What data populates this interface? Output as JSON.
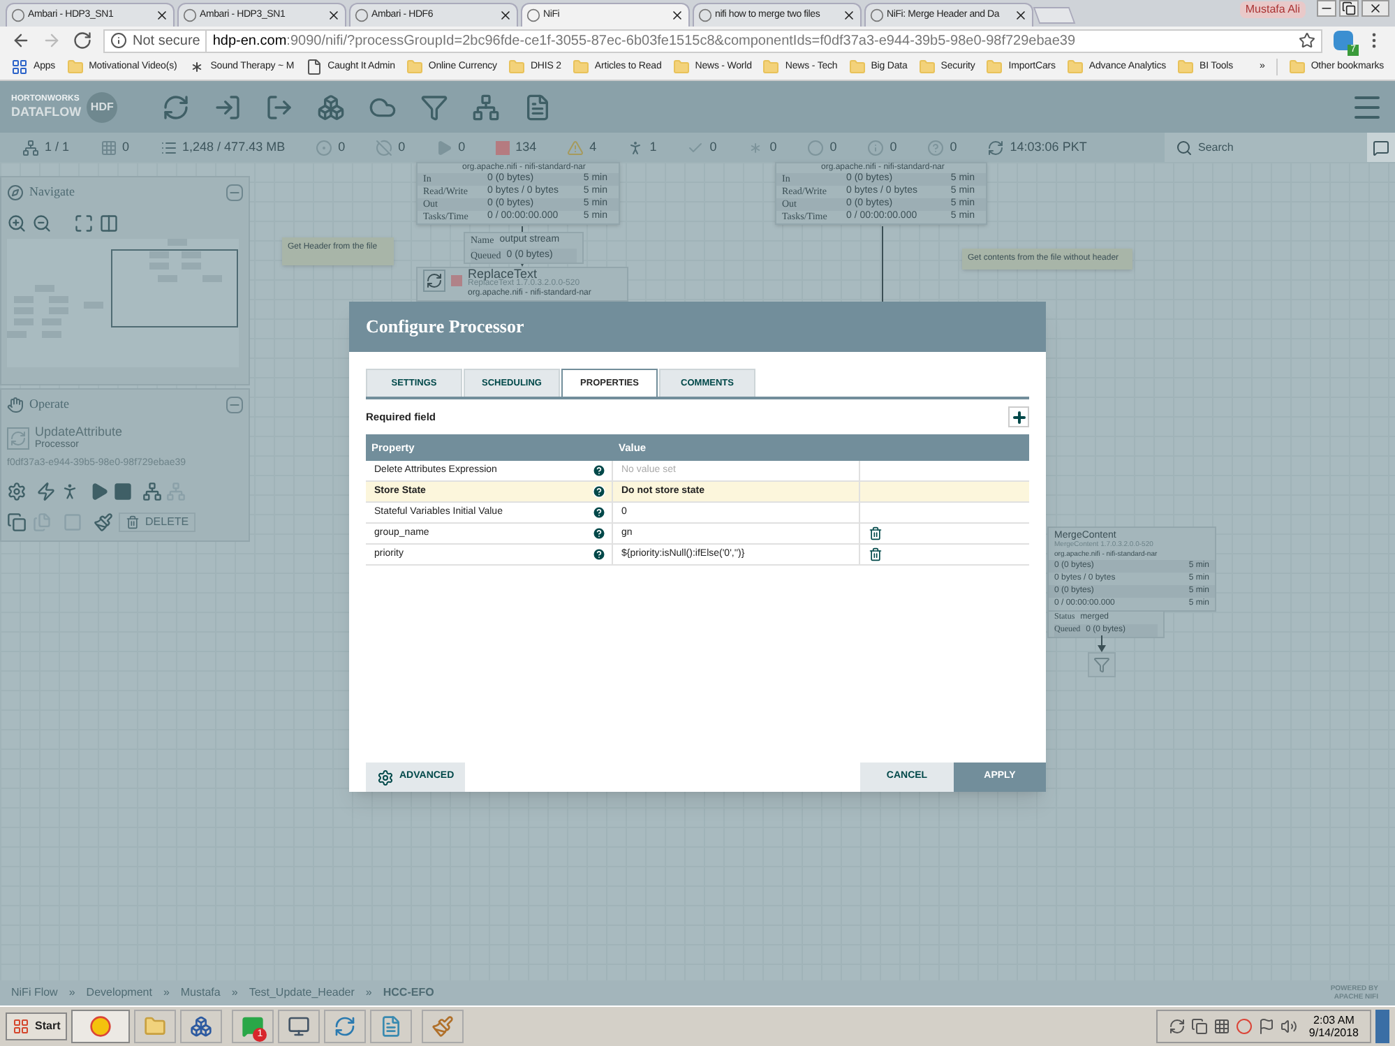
{
  "browser": {
    "tabs": [
      {
        "title": "Ambari - HDP3_SN1",
        "selected": false
      },
      {
        "title": "Ambari - HDP3_SN1",
        "selected": false
      },
      {
        "title": "Ambari - HDF6",
        "selected": false
      },
      {
        "title": "NiFi",
        "selected": true
      },
      {
        "title": "nifi how to merge two files",
        "selected": false
      },
      {
        "title": "NiFi: Merge Header and Da",
        "selected": false
      }
    ],
    "profile": "Mustafa Ali",
    "address": {
      "security": "Not secure",
      "host": "hdp-en.com",
      "path": ":9090/nifi/?processGroupId=2bc96fde-ce1f-3055-87ec-6b03fe1515c8&componentIds=f0df37a3-e944-39b5-98e0-98f729ebae39"
    },
    "extension_badge": "7",
    "bookmarks": [
      {
        "kind": "apps",
        "label": "Apps"
      },
      {
        "kind": "folder",
        "label": "Motivational Video(s)"
      },
      {
        "kind": "star",
        "label": "Sound Therapy ~ M"
      },
      {
        "kind": "page",
        "label": "Caught It Admin"
      },
      {
        "kind": "folder",
        "label": "Online Currency"
      },
      {
        "kind": "folder",
        "label": "DHIS 2"
      },
      {
        "kind": "folder",
        "label": "Articles to Read"
      },
      {
        "kind": "folder",
        "label": "News - World"
      },
      {
        "kind": "folder",
        "label": "News - Tech"
      },
      {
        "kind": "folder",
        "label": "Big Data"
      },
      {
        "kind": "folder",
        "label": "Security"
      },
      {
        "kind": "folder",
        "label": "ImportCars"
      },
      {
        "kind": "folder",
        "label": "Advance Analytics"
      },
      {
        "kind": "folder",
        "label": "BI Tools"
      }
    ],
    "more": "»",
    "other_bookmarks": "Other bookmarks"
  },
  "nifi": {
    "logo": {
      "brand": "HORTONWORKS",
      "product": "DATAFLOW",
      "badge": "HDF"
    },
    "status": [
      {
        "kind": "cluster",
        "text": "1 / 1"
      },
      {
        "kind": "grid",
        "text": "0"
      },
      {
        "kind": "queue",
        "text": "1,248 / 477.43 MB"
      },
      {
        "kind": "transmitting",
        "text": "0"
      },
      {
        "kind": "not-transmitting",
        "text": "0"
      },
      {
        "kind": "running",
        "text": "0"
      },
      {
        "kind": "stopped",
        "text": "134"
      },
      {
        "kind": "invalid",
        "text": "4"
      },
      {
        "kind": "disabled",
        "text": "1"
      },
      {
        "kind": "up-to-date",
        "text": "0"
      },
      {
        "kind": "modified",
        "text": "0"
      },
      {
        "kind": "stale",
        "text": "0"
      },
      {
        "kind": "errors",
        "text": "0"
      },
      {
        "kind": "unknown",
        "text": "0"
      },
      {
        "kind": "refresh",
        "text": "14:03:06 PKT"
      }
    ],
    "search": {
      "placeholder": "Search"
    },
    "navigate": {
      "title": "Navigate"
    },
    "operate": {
      "title": "Operate",
      "name": "UpdateAttribute",
      "type": "Processor",
      "id": "f0df37a3-e944-39b5-98e0-98f729ebae39",
      "delete": "DELETE"
    },
    "canvas": {
      "processors": [
        {
          "nar": "org.apache.nifi - nifi-standard-nar",
          "rows": [
            {
              "label": "In",
              "value": "0 (0 bytes)",
              "period": "5 min"
            },
            {
              "label": "Read/Write",
              "value": "0 bytes / 0 bytes",
              "period": "5 min"
            },
            {
              "label": "Out",
              "value": "0 (0 bytes)",
              "period": "5 min"
            },
            {
              "label": "Tasks/Time",
              "value": "0 / 00:00:00.000",
              "period": "5 min"
            }
          ]
        },
        {
          "nar": "org.apache.nifi - nifi-standard-nar",
          "rows": [
            {
              "label": "In",
              "value": "0 (0 bytes)",
              "period": "5 min"
            },
            {
              "label": "Read/Write",
              "value": "0 bytes / 0 bytes",
              "period": "5 min"
            },
            {
              "label": "Out",
              "value": "0 (0 bytes)",
              "period": "5 min"
            },
            {
              "label": "Tasks/Time",
              "value": "0 / 00:00:00.000",
              "period": "5 min"
            }
          ]
        }
      ],
      "connection": {
        "name_label": "Name",
        "name": "output stream",
        "queued_label": "Queued",
        "queued": "0 (0 bytes)"
      },
      "replace_text": {
        "name": "ReplaceText",
        "version": "ReplaceText 1.7.0.3.2.0.0-520",
        "nar": "org.apache.nifi - nifi-standard-nar"
      },
      "labels": [
        "Get Header from the file",
        "Get contents from the file without header"
      ],
      "merge": {
        "name": "MergeContent",
        "version": "MergeContent 1.7.0.3.2.0.0-520",
        "nar": "org.apache.nifi - nifi-standard-nar",
        "rows": [
          {
            "value": "0 (0 bytes)",
            "period": "5 min"
          },
          {
            "value": "0 bytes / 0 bytes",
            "period": "5 min"
          },
          {
            "value": "0 (0 bytes)",
            "period": "5 min"
          },
          {
            "value": "0 / 00:00:00.000",
            "period": "5 min"
          }
        ]
      },
      "merge_connection": {
        "status_label": "Status",
        "status": "merged",
        "queued_label": "Queued",
        "queued": "0 (0 bytes)"
      }
    },
    "dialog": {
      "title": "Configure Processor",
      "tabs": [
        {
          "label": "SETTINGS",
          "selected": false
        },
        {
          "label": "SCHEDULING",
          "selected": false
        },
        {
          "label": "PROPERTIES",
          "selected": true
        },
        {
          "label": "COMMENTS",
          "selected": false
        }
      ],
      "required": "Required field",
      "columns": [
        "Property",
        "Value"
      ],
      "rows": [
        {
          "property": "Delete Attributes Expression",
          "value": "No value set",
          "unset": true,
          "selected": false,
          "deletable": false
        },
        {
          "property": "Store State",
          "value": "Do not store state",
          "unset": false,
          "selected": true,
          "deletable": false
        },
        {
          "property": "Stateful Variables Initial Value",
          "value": "0",
          "unset": false,
          "selected": false,
          "deletable": false
        },
        {
          "property": "group_name",
          "value": "gn",
          "unset": false,
          "selected": false,
          "deletable": true
        },
        {
          "property": "priority",
          "value": "${priority:isNull():ifElse('0','')}",
          "unset": false,
          "selected": false,
          "deletable": true
        }
      ],
      "advanced": "ADVANCED",
      "cancel": "CANCEL",
      "apply": "APPLY"
    },
    "breadcrumbs": [
      "NiFi Flow",
      "Development",
      "Mustafa",
      "Test_Update_Header",
      "HCC-EFO"
    ],
    "separator": "»",
    "powered": {
      "line1": "POWERED BY",
      "line2": "APACHE NIFI"
    }
  },
  "taskbar": {
    "start": "Start",
    "whatsapp_badge": "1",
    "time": "2:03 AM",
    "date": "9/14/2018"
  }
}
